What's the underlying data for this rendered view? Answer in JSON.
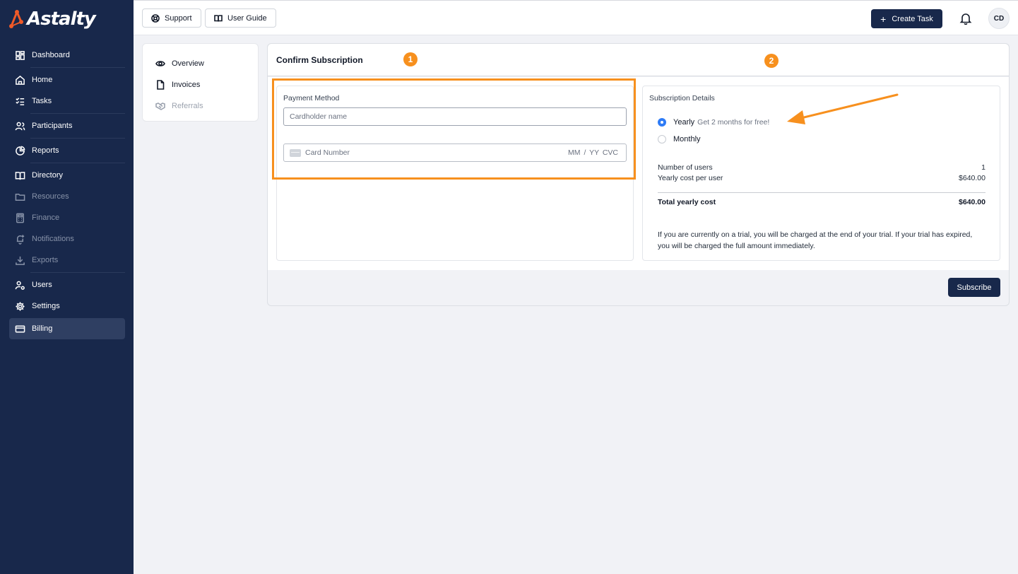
{
  "app": {
    "brand": "Astalty"
  },
  "sidebar": {
    "items": [
      {
        "label": "Dashboard",
        "icon": "dashboard-icon"
      },
      {
        "label": "Home",
        "icon": "home-icon"
      },
      {
        "label": "Tasks",
        "icon": "tasks-icon"
      },
      {
        "label": "Participants",
        "icon": "participants-icon"
      },
      {
        "label": "Reports",
        "icon": "reports-icon"
      },
      {
        "label": "Directory",
        "icon": "directory-icon"
      },
      {
        "label": "Resources",
        "icon": "folder-icon"
      },
      {
        "label": "Finance",
        "icon": "calculator-icon"
      },
      {
        "label": "Notifications",
        "icon": "bell-plus-icon"
      },
      {
        "label": "Exports",
        "icon": "download-icon"
      },
      {
        "label": "Users",
        "icon": "user-settings-icon"
      },
      {
        "label": "Settings",
        "icon": "gear-icon"
      },
      {
        "label": "Billing",
        "icon": "credit-card-icon"
      }
    ]
  },
  "topbar": {
    "support_label": "Support",
    "guide_label": "User Guide",
    "create_label": "Create Task",
    "avatar_initials": "CD"
  },
  "submenu": {
    "items": [
      {
        "label": "Overview"
      },
      {
        "label": "Invoices"
      },
      {
        "label": "Referrals"
      }
    ]
  },
  "panel": {
    "title": "Confirm Subscription",
    "payment": {
      "title": "Payment Method",
      "cardholder_placeholder": "Cardholder name",
      "card_number_placeholder": "Card Number",
      "expiry_cvc_placeholder": "MM / YY  CVC"
    },
    "details": {
      "title": "Subscription Details",
      "yearly_label": "Yearly",
      "yearly_hint": "Get 2 months for free!",
      "monthly_label": "Monthly",
      "users_label": "Number of users",
      "users_value": "1",
      "cost_label": "Yearly cost per user",
      "cost_value": "$640.00",
      "total_label": "Total yearly cost",
      "total_value": "$640.00",
      "note": "If you are currently on a trial, you will be charged at the end of your trial. If your trial has expired, you will be charged the full amount immediately."
    },
    "subscribe_label": "Subscribe"
  },
  "annotations": {
    "badge_1": "1",
    "badge_2": "2",
    "color": "#f7901e"
  },
  "colors": {
    "sidebar": "#18284b",
    "primary": "#18284b",
    "radio": "#2f7cf6"
  }
}
